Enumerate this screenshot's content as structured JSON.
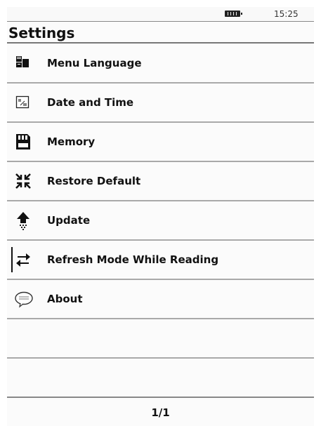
{
  "status": {
    "time": "15:25"
  },
  "header": {
    "title": "Settings"
  },
  "menu": {
    "items": [
      {
        "label": "Menu Language",
        "icon": "language-icon"
      },
      {
        "label": "Date and Time",
        "icon": "calendar-icon"
      },
      {
        "label": "Memory",
        "icon": "memory-card-icon"
      },
      {
        "label": "Restore Default",
        "icon": "restore-arrows-icon"
      },
      {
        "label": "Update",
        "icon": "update-arrow-icon"
      },
      {
        "label": "Refresh Mode While Reading",
        "icon": "refresh-icon",
        "selected": true
      },
      {
        "label": "About",
        "icon": "speech-bubble-icon"
      }
    ]
  },
  "footer": {
    "page": "1/1"
  }
}
